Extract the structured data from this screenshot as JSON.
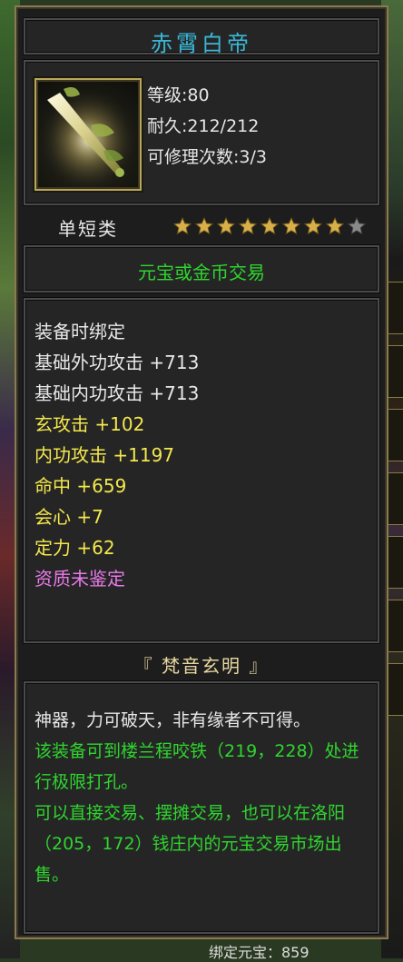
{
  "item": {
    "name": "赤霄白帝",
    "level": "等级:80",
    "durability": "耐久:212/212",
    "repair": "可修理次数:3/3",
    "type": "单短类",
    "stars": {
      "filled": 8,
      "total": 9
    },
    "trade": "元宝或金币交易",
    "attributes": [
      {
        "text": "装备时绑定",
        "color": "white"
      },
      {
        "text": "基础外功攻击 +713",
        "color": "white"
      },
      {
        "text": "基础内功攻击 +713",
        "color": "white"
      },
      {
        "text": "玄攻击 +102",
        "color": "yellow"
      },
      {
        "text": "内功攻击 +1197",
        "color": "yellow"
      },
      {
        "text": "命中 +659",
        "color": "yellow"
      },
      {
        "text": "会心 +7",
        "color": "yellow"
      },
      {
        "text": "定力 +62",
        "color": "yellow"
      },
      {
        "text": "资质未鉴定",
        "color": "pink"
      }
    ],
    "soul": "『 梵音玄明 』",
    "description": [
      {
        "text": "神器，力可破天，非有缘者不可得。",
        "color": "white"
      },
      {
        "text": "该装备可到楼兰程咬铁（219，228）处进行极限打孔。",
        "color": "green"
      },
      {
        "text": "可以直接交易、摆摊交易，也可以在洛阳（205，172）钱庄内的元宝交易市场出售。",
        "color": "green"
      }
    ]
  },
  "background": {
    "bottom_text": "绑定元宝：859"
  },
  "icon_names": {
    "weapon": "sword-icon",
    "star": "star-icon"
  }
}
